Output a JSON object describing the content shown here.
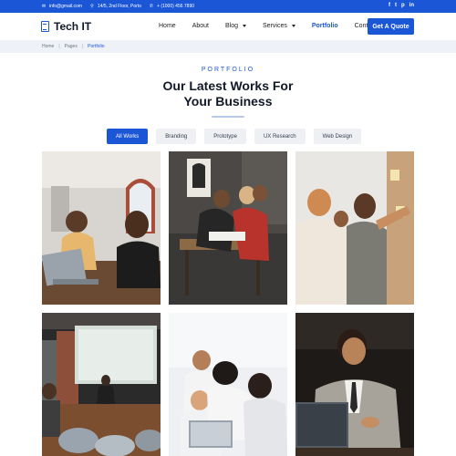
{
  "topbar": {
    "email": "info@gmail.com",
    "address": "14/5, 2nd Floor, Porto",
    "phone": "+ (1000) 456 7890",
    "social": [
      {
        "icon": "facebook-icon",
        "glyph": "f"
      },
      {
        "icon": "twitter-icon",
        "glyph": "t"
      },
      {
        "icon": "pinterest-icon",
        "glyph": "p"
      },
      {
        "icon": "linkedin-icon",
        "glyph": "in"
      }
    ]
  },
  "header": {
    "logo_text": "Tech IT",
    "nav": [
      {
        "label": "Home"
      },
      {
        "label": "About"
      },
      {
        "label": "Blog"
      },
      {
        "label": "Services"
      },
      {
        "label": "Portfolio"
      },
      {
        "label": "Contact"
      }
    ],
    "quote_button": "Get A Quote"
  },
  "breadcrumb": [
    "Home",
    "Pages",
    "Portfolio"
  ],
  "section": {
    "eyebrow": "PORTFOLIO",
    "heading_line1": "Our Latest Works For",
    "heading_line2": "Your Business"
  },
  "filters": [
    "All Works",
    "Branding",
    "Prototype",
    "UX Research",
    "Web Design"
  ],
  "colors": {
    "primary": "#1a56d6",
    "breadcrumb_bg": "#eef2f8",
    "filter_bg": "#eef0f3",
    "heading": "#111827"
  }
}
